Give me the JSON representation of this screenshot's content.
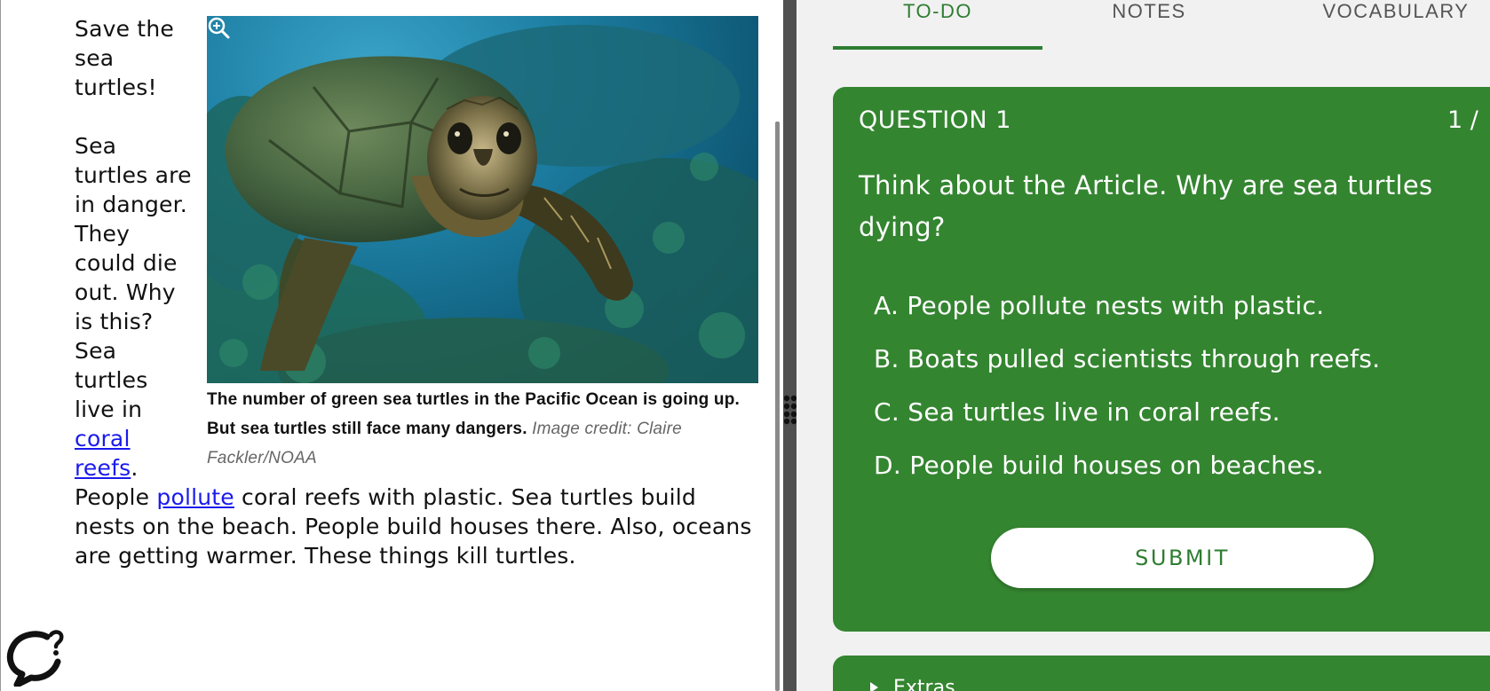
{
  "article": {
    "title_lines": [
      "Save the",
      "sea",
      "turtles!"
    ],
    "body_before_link": "Sea turtles are in danger. They could die out. Why is this? Sea turtles live in ",
    "link_coral_reefs": "coral reefs",
    "text_after_link1": ". People ",
    "link_pollute": "pollute",
    "text_after_link2": " coral reefs with plastic. Sea turtles build nests on the beach. People build houses there. Also, oceans are getting warmer. These things kill turtles.",
    "caption_bold": "The number of green sea turtles in the Pacific Ocean is going up. But sea turtles still face many dangers.",
    "caption_credit": "Image credit: Claire Fackler/NOAA"
  },
  "tabs": [
    {
      "label": "TO-DO",
      "active": true
    },
    {
      "label": "NOTES",
      "active": false
    },
    {
      "label": "VOCABULARY",
      "active": false
    }
  ],
  "question": {
    "header": "QUESTION 1",
    "count": "1 /",
    "text": "Think about the Article. Why are sea turtles dying?",
    "answers": [
      "A. People pollute nests with plastic.",
      "B. Boats pulled scientists through reefs.",
      "C. Sea turtles live in coral reefs.",
      "D. People build houses on beaches."
    ],
    "submit_label": "SUBMIT"
  },
  "extras": {
    "label": "Extras"
  },
  "colors": {
    "accent_green": "#2e7d32",
    "card_green": "#348530",
    "link_blue": "#1a1aee"
  },
  "icons": [
    "zoom-in-icon",
    "drag-handle-icon",
    "chat-help-icon"
  ]
}
